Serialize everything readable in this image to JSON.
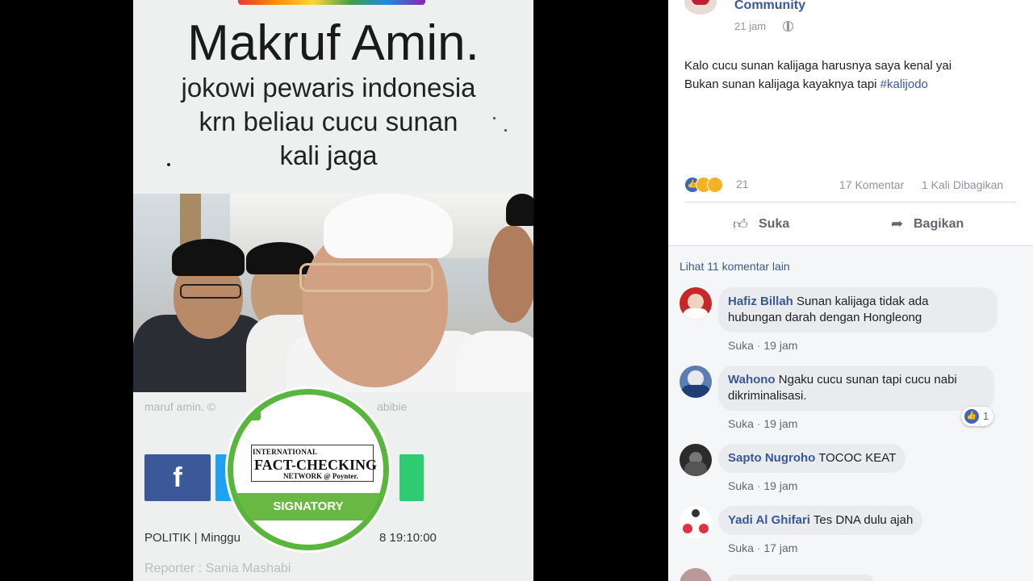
{
  "news_image": {
    "headline": "Makruf Amin.",
    "quote_line1": "jokowi pewaris indonesia",
    "quote_line2": "krn beliau cucu sunan",
    "quote_line3": "kali jaga",
    "photo_caption": "maruf amin. ©",
    "photo_caption_suffix": "abibie",
    "share_facebook_glyph": "f",
    "article_category": "POLITIK | Minggu",
    "article_time": "8 19:10:00",
    "reporter": "Reporter : Sania Mashabi",
    "ifcn_badge": {
      "line1": "INTERNATIONAL",
      "line2": "FACT-CHECKING",
      "line3": "NETWORK @ Poynter.",
      "band": "SIGNATORY"
    }
  },
  "post": {
    "page_name": "Community",
    "time": "21 jam",
    "text_line1": "Kalo cucu sunan kalijaga harusnya saya kenal yai",
    "text_line2": "Bukan sunan kalijaga kayaknya tapi ",
    "hashtag": "#kalijodo",
    "reaction_count": "21",
    "comment_count": "17 Komentar",
    "share_count": "1 Kali Dibagikan",
    "like_label": "Suka",
    "share_label": "Bagikan"
  },
  "comments": {
    "more_link": "Lihat 11 komentar lain",
    "items": [
      {
        "name": "Hafiz Billah",
        "text": "Sunan kalijaga tidak ada",
        "text2": "hubungan darah dengan Hongleong",
        "action": "Suka",
        "time": "19 jam"
      },
      {
        "name": "Wahono",
        "text": "Ngaku cucu sunan tapi cucu nabi",
        "text2": "dikriminalisasi.",
        "action": "Suka",
        "time": "19 jam",
        "reaction_count": "1"
      },
      {
        "name": "Sapto Nugroho",
        "text": "TOCOC KEAT",
        "action": "Suka",
        "time": "19 jam"
      },
      {
        "name": "Yadi Al Ghifari",
        "text": "Tes DNA dulu ajah",
        "action": "Suka",
        "time": "17 jam"
      }
    ]
  },
  "icons": {
    "like": "thumbs-up-icon",
    "share": "share-arrow-icon",
    "privacy": "globe-icon"
  },
  "colors": {
    "facebook_blue": "#385898",
    "ifcn_green": "#57b63b"
  }
}
